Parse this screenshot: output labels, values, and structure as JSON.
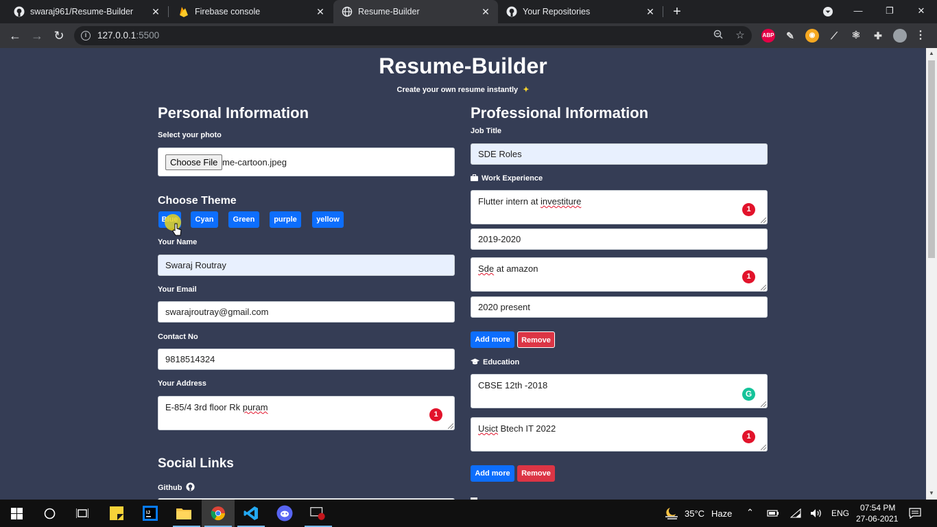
{
  "browser": {
    "tabs": [
      {
        "title": "swaraj961/Resume-Builder",
        "icon": "github-icon",
        "active": false
      },
      {
        "title": "Firebase console",
        "icon": "firebase-icon",
        "active": false
      },
      {
        "title": "Resume-Builder",
        "icon": "globe-icon",
        "active": true
      },
      {
        "title": "Your Repositories",
        "icon": "github-icon",
        "active": false
      }
    ],
    "url_host": "127.0.0.1",
    "url_port": ":5500",
    "extensions": [
      {
        "label": "ABP",
        "color": "#e40046"
      }
    ]
  },
  "page": {
    "title": "Resume-Builder",
    "subtitle": "Create your own resume instantly",
    "subtitle_icon": "sparkle-icon",
    "personal": {
      "heading": "Personal Information",
      "photo_label": "Select your photo",
      "file_button": "Choose File",
      "file_name": "me-cartoon.jpeg",
      "theme_heading": "Choose Theme",
      "themes": [
        "Blue",
        "Cyan",
        "Green",
        "purple",
        "yellow"
      ],
      "name_label": "Your Name",
      "name_value": "Swaraj Routray",
      "email_label": "Your Email",
      "email_value": "swarajroutray@gmail.com",
      "contact_label": "Contact No",
      "contact_value": "9818514324",
      "address_label": "Your Address",
      "address_value_a": "E-85/4 3rd floor Rk ",
      "address_value_b": "puram",
      "address_badge": "1"
    },
    "social": {
      "heading": "Social Links",
      "github_label": "Github"
    },
    "professional": {
      "heading": "Professional Information",
      "job_label": "Job Title",
      "job_value": "SDE Roles",
      "work_label": "Work Experience",
      "work": [
        {
          "desc_a": "Flutter intern at ",
          "desc_b": "investiture",
          "badge": "1",
          "duration": "2019-2020"
        },
        {
          "desc_a": "",
          "desc_b": "Sde",
          "desc_c": " at amazon",
          "badge": "1",
          "duration": "2020 present"
        }
      ],
      "add_more": "Add more",
      "remove": "Remove",
      "education_label": "Education",
      "education": [
        {
          "text": "CBSE 12th -2018"
        },
        {
          "text_a": "Usict",
          "text_b": " Btech IT 2022",
          "badge": "1"
        }
      ],
      "grammarly_icon": "G"
    }
  },
  "taskbar": {
    "weather": "35°C",
    "weather_desc": "Haze",
    "lang": "ENG",
    "time": "07:54 PM",
    "date": "27-06-2021"
  }
}
